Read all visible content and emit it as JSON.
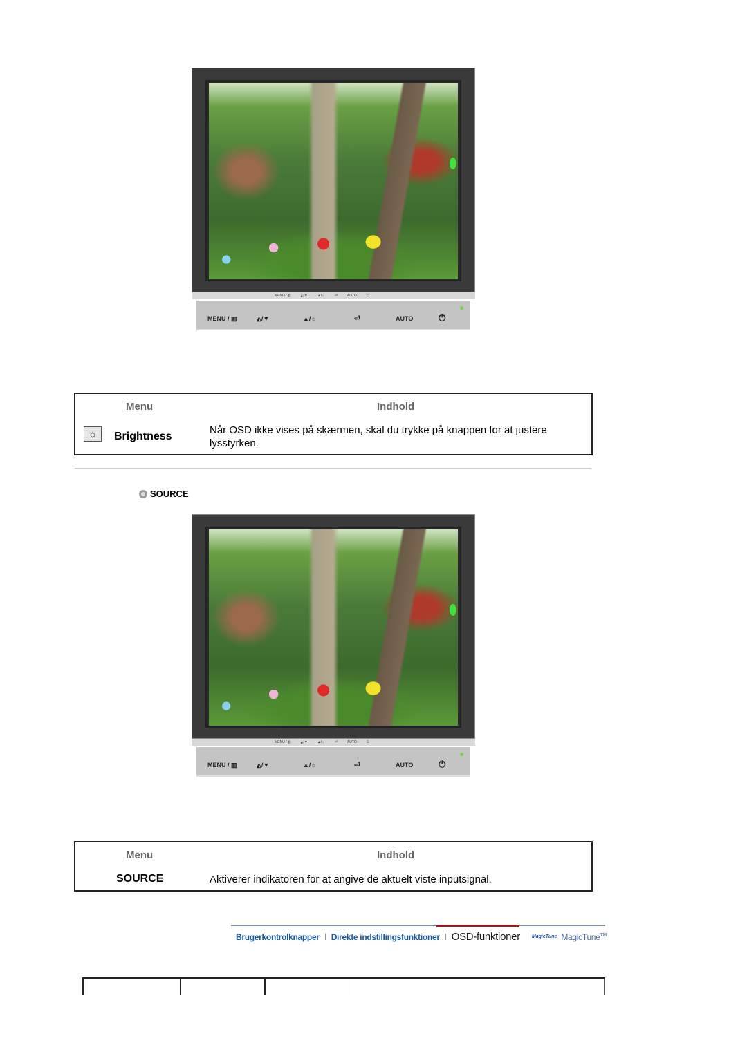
{
  "monitor_panel": {
    "strip_labels": [
      "MENU / ▥",
      "◭/▼",
      "▲/☼",
      "⏎",
      "AUTO",
      "⏻"
    ],
    "buttons": [
      {
        "label": "MENU / ▥",
        "icon": "menu-icon"
      },
      {
        "label": "◭/▼",
        "icon": "magicbright-down-icon"
      },
      {
        "label": "▲/☼",
        "icon": "up-brightness-icon"
      },
      {
        "label": "⏎",
        "icon": "enter-source-icon"
      },
      {
        "label": "AUTO",
        "icon": "auto-icon"
      },
      {
        "label": "⏻",
        "icon": "power-icon"
      }
    ],
    "led_color": "#7ad04a"
  },
  "brightness_table": {
    "header_menu": "Menu",
    "header_content": "Indhold",
    "icon": "brightness-icon",
    "icon_glyph": "☼",
    "name": "Brightness",
    "description": "Når OSD ikke vises på skærmen, skal du trykke på knappen for at justere lysstyrken."
  },
  "source_section": {
    "icon": "source-icon",
    "title": "SOURCE"
  },
  "source_table": {
    "header_menu": "Menu",
    "header_content": "Indhold",
    "name": "SOURCE",
    "description": "Aktiverer indikatoren for at angive de aktuelt viste inputsignal."
  },
  "bottom_nav": {
    "items": [
      {
        "label": "Brugerkontrolknapper",
        "active": false
      },
      {
        "label": "Direkte indstillingsfunktioner",
        "active": false
      },
      {
        "label": "OSD-funktioner",
        "active": true
      },
      {
        "label": "MagicTune",
        "active": false
      }
    ],
    "magictune_logo": "MagicTune",
    "trademark": "TM",
    "active_color": "#a01818",
    "link_color": "#1a5a9a"
  }
}
